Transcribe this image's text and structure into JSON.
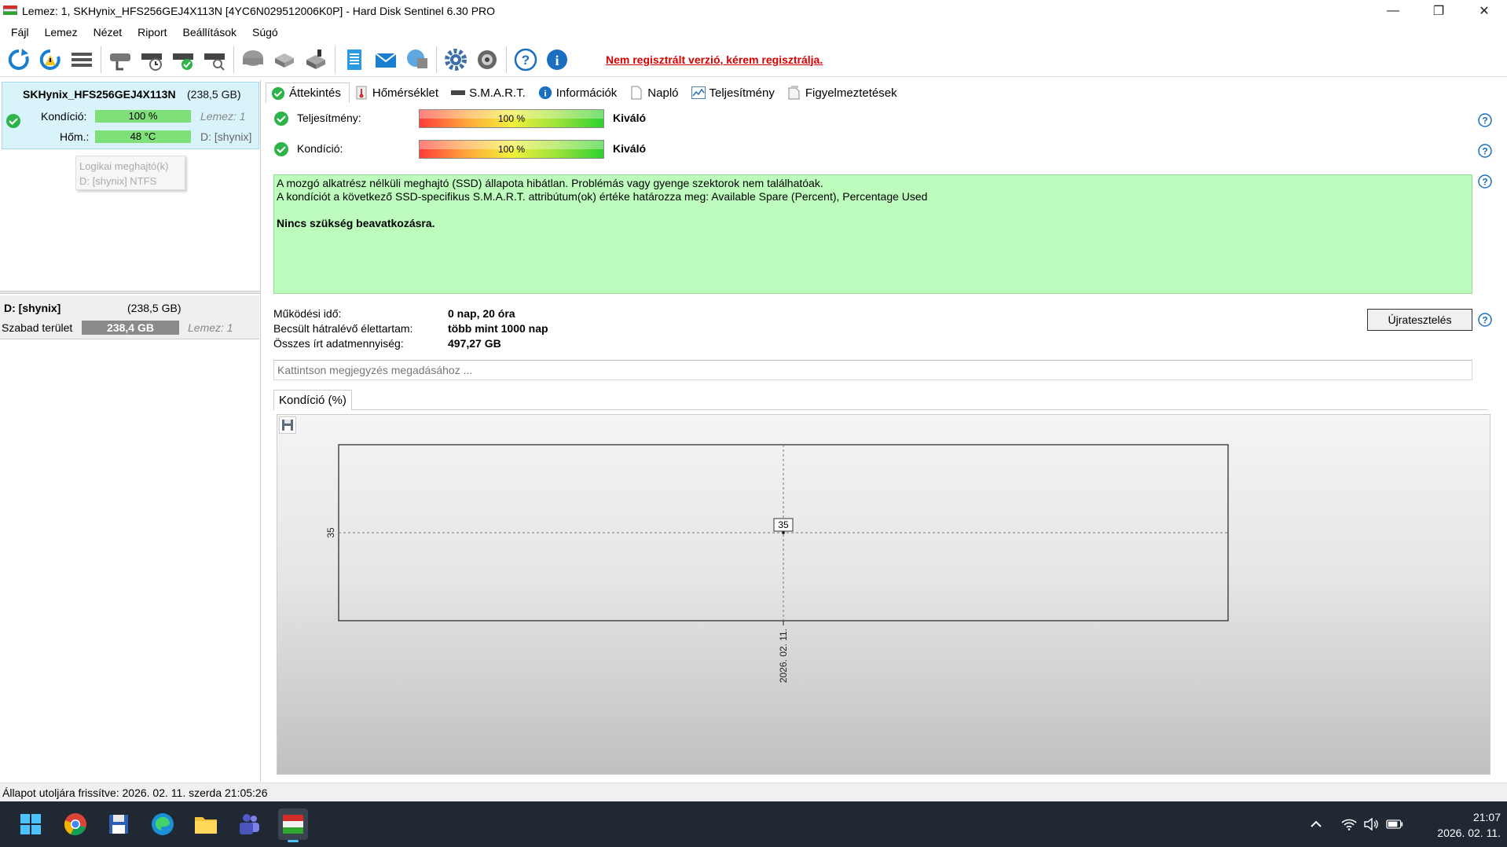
{
  "window": {
    "title": "Lemez: 1, SKHynix_HFS256GEJ4X113N [4YC6N029512006K0P]  -  Hard Disk Sentinel 6.30 PRO",
    "minimize": "—",
    "restore": "❐",
    "close": "✕"
  },
  "menu": {
    "items": [
      "Fájl",
      "Lemez",
      "Nézet",
      "Riport",
      "Beállítások",
      "Súgó"
    ]
  },
  "toolbar": {
    "register_warning": "Nem regisztrált verzió, kérem regisztrálja."
  },
  "disk": {
    "name": "SKHynix_HFS256GEJ4X113N",
    "size": "(238,5 GB)",
    "condition_label": "Kondíció:",
    "condition_value": "100 %",
    "condition_fraction": 1.0,
    "disk_ref": "Lemez: 1",
    "temp_label": "Hőm.:",
    "temp_value": "48 °C",
    "volume_ref": "D: [shynix]",
    "tooltip_line1": "Logikai meghajtó(k)",
    "tooltip_line2": "D: [shynix] NTFS"
  },
  "volume": {
    "name": "D: [shynix]",
    "size": "(238,5 GB)",
    "free_label": "Szabad terület",
    "free_value": "238,4 GB",
    "disk_ref": "Lemez: 1"
  },
  "tabs": [
    {
      "label": "Áttekintés",
      "icon": "check-circle-icon"
    },
    {
      "label": "Hőmérséklet",
      "icon": "thermometer-icon"
    },
    {
      "label": "S.M.A.R.T.",
      "icon": "drive-icon"
    },
    {
      "label": "Információk",
      "icon": "info-icon"
    },
    {
      "label": "Napló",
      "icon": "document-icon"
    },
    {
      "label": "Teljesítmény",
      "icon": "performance-chart-icon"
    },
    {
      "label": "Figyelmeztetések",
      "icon": "alerts-icon"
    }
  ],
  "overview": {
    "performance_label": "Teljesítmény:",
    "performance_value": "100 %",
    "performance_fraction": 1.0,
    "performance_rating": "Kiváló",
    "condition_label": "Kondíció:",
    "condition_value": "100 %",
    "condition_fraction": 1.0,
    "condition_rating": "Kiváló",
    "message_line1": "A mozgó alkatrész nélküli meghajtó (SSD) állapota hibátlan. Problémás vagy gyenge szektorok nem találhatóak.",
    "message_line2": "A kondíciót a következő SSD-specifikus S.M.A.R.T. attribútum(ok) értéke határozza meg:  Available Spare (Percent), Percentage Used",
    "message_action": "Nincs szükség beavatkozásra.",
    "uptime_label": "Működési idő:",
    "uptime_value": "0 nap, 20 óra",
    "lifetime_label": "Becsült hátralévő élettartam:",
    "lifetime_value": "több mint 1000 nap",
    "written_label": "Összes írt adatmennyiség:",
    "written_value": "497,27 GB",
    "retest_button": "Újratesztelés",
    "note_placeholder": "Kattintson megjegyzés megadásához ..."
  },
  "chart_tab": "Kondíció  (%)",
  "chart_data": {
    "type": "line",
    "title": "",
    "xlabel": "",
    "ylabel": "",
    "x": [
      "2026. 02. 11."
    ],
    "series": [
      {
        "values": [
          35
        ]
      }
    ],
    "y_tick_labels": [
      "35"
    ],
    "data_labels": [
      "35"
    ],
    "grid": true
  },
  "statusbar": {
    "text": "Állapot utoljára frissítve: 2026. 02. 11. szerda 21:05:26"
  },
  "taskbar": {
    "time": "21:07",
    "date": "2026. 02. 11."
  },
  "colors": {
    "accent_red": "#d40000",
    "ok_green": "#2db34a",
    "message_bg": "#bdfcbd",
    "disk_card_bg": "#d9f3fa",
    "taskbar_bg": "#202833"
  }
}
